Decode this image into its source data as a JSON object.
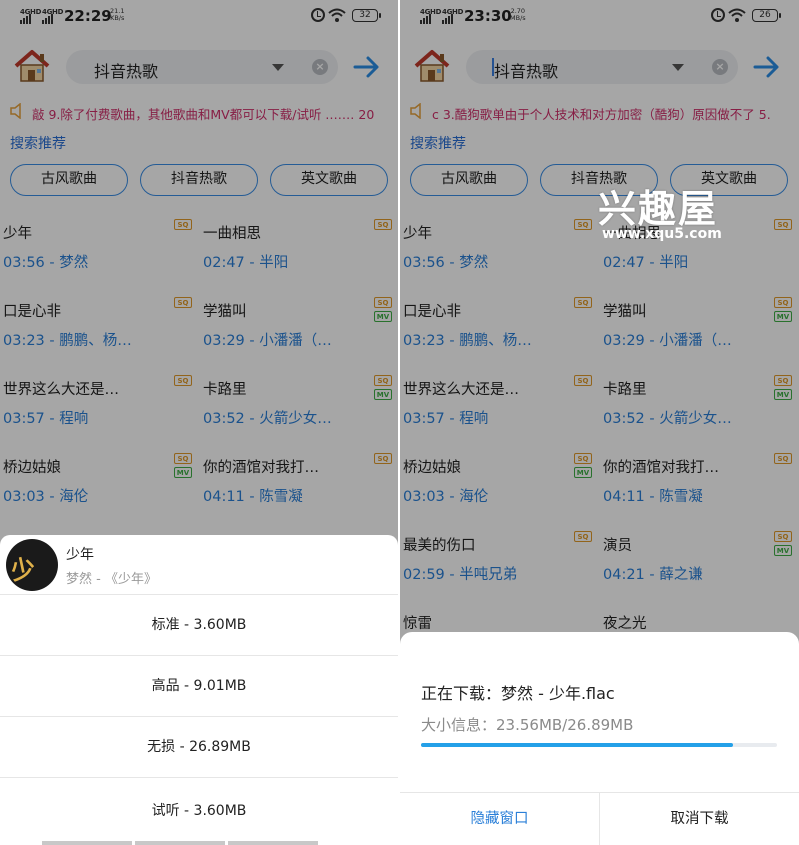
{
  "left": {
    "status": {
      "net1": "4GHD",
      "net2": "4GHD",
      "time": "22:29",
      "speed_value": "21.1",
      "speed_unit": "KB/s",
      "battery": "32"
    },
    "search": {
      "value": "抖音热歌"
    },
    "notice": "敲 9.除了付费歌曲，其他歌曲和MV都可以下载/试听 .…… 20",
    "rec_title": "搜索推荐",
    "tags": [
      "古风歌曲",
      "抖音热歌",
      "英文歌曲"
    ],
    "songs": [
      {
        "name": "少年",
        "sub": "03:56 - 梦然",
        "sq": "SQ",
        "mv": ""
      },
      {
        "name": "一曲相思",
        "sub": "02:47 - 半阳",
        "sq": "SQ",
        "mv": ""
      },
      {
        "name": "口是心非",
        "sub": "03:23 - 鹏鹏、杨…",
        "sq": "SQ",
        "mv": ""
      },
      {
        "name": "学猫叫",
        "sub": "03:29 - 小潘潘（…",
        "sq": "SQ",
        "mv": "MV"
      },
      {
        "name": "世界这么大还是…",
        "sub": "03:57 - 程响",
        "sq": "SQ",
        "mv": ""
      },
      {
        "name": "卡路里",
        "sub": "03:52 - 火箭少女…",
        "sq": "SQ",
        "mv": "MV"
      },
      {
        "name": "桥边姑娘",
        "sub": "03:03 - 海伦",
        "sq": "SQ",
        "mv": "MV"
      },
      {
        "name": "你的酒馆对我打…",
        "sub": "04:11 - 陈雪凝",
        "sq": "SQ",
        "mv": ""
      }
    ],
    "sheet": {
      "cover_glyph": "少年",
      "title": "少年",
      "subtitle": "梦然 - 《少年》",
      "options": [
        "标准 - 3.60MB",
        "高品 - 9.01MB",
        "无损 - 26.89MB",
        "试听 - 3.60MB"
      ]
    }
  },
  "right": {
    "status": {
      "net1": "4GHD",
      "net2": "4GHD",
      "time": "23:30",
      "speed_value": "2.70",
      "speed_unit": "MB/s",
      "battery": "26"
    },
    "search": {
      "value": "抖音热歌"
    },
    "notice": "c 3.酷狗歌单由于个人技术和对方加密（酷狗）原因做不了 5.",
    "rec_title": "搜索推荐",
    "tags": [
      "古风歌曲",
      "抖音热歌",
      "英文歌曲"
    ],
    "songs": [
      {
        "name": "少年",
        "sub": "03:56 - 梦然",
        "sq": "SQ",
        "mv": ""
      },
      {
        "name": "一曲相思",
        "sub": "02:47 - 半阳",
        "sq": "SQ",
        "mv": ""
      },
      {
        "name": "口是心非",
        "sub": "03:23 - 鹏鹏、杨…",
        "sq": "SQ",
        "mv": ""
      },
      {
        "name": "学猫叫",
        "sub": "03:29 - 小潘潘（…",
        "sq": "SQ",
        "mv": "MV"
      },
      {
        "name": "世界这么大还是…",
        "sub": "03:57 - 程响",
        "sq": "SQ",
        "mv": ""
      },
      {
        "name": "卡路里",
        "sub": "03:52 - 火箭少女…",
        "sq": "SQ",
        "mv": "MV"
      },
      {
        "name": "桥边姑娘",
        "sub": "03:03 - 海伦",
        "sq": "SQ",
        "mv": "MV"
      },
      {
        "name": "你的酒馆对我打…",
        "sub": "04:11 - 陈雪凝",
        "sq": "SQ",
        "mv": ""
      },
      {
        "name": "最美的伤口",
        "sub": "02:59 - 半吨兄弟",
        "sq": "SQ",
        "mv": ""
      },
      {
        "name": "演员",
        "sub": "04:21 - 薛之谦",
        "sq": "SQ",
        "mv": "MV"
      },
      {
        "name": "惊雷",
        "sub": "",
        "sq": "",
        "mv": ""
      },
      {
        "name": "夜之光",
        "sub": "",
        "sq": "",
        "mv": ""
      }
    ],
    "dialog": {
      "title": "正在下载：梦然 - 少年.flac",
      "size_info": "大小信息：23.56MB/26.89MB",
      "progress": 0.876,
      "hide_label": "隐藏窗口",
      "cancel_label": "取消下载"
    }
  },
  "watermark": {
    "title": "兴趣屋",
    "url": "www.xqu5.com"
  },
  "colors": {
    "accent": "#2a7fd8",
    "notice": "#d02f6a",
    "sq_badge": "#e19a2a",
    "mv_badge": "#3fae45",
    "progress": "#24a0e8"
  }
}
